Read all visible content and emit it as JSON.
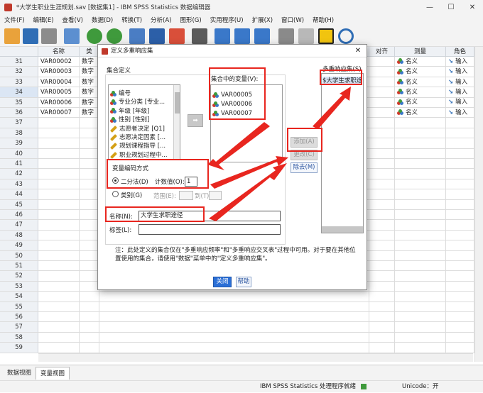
{
  "window": {
    "title": "*大学生职业生涯规划.sav [数据集1] - IBM SPSS Statistics 数据编辑器",
    "minimize": "—",
    "maximize": "☐",
    "close": "✕"
  },
  "menu": [
    "文件(F)",
    "编辑(E)",
    "查看(V)",
    "数据(D)",
    "转换(T)",
    "分析(A)",
    "图形(G)",
    "实用程序(U)",
    "扩展(X)",
    "窗口(W)",
    "帮助(H)"
  ],
  "sheet": {
    "headers": {
      "name": "名称",
      "type": "类",
      "align": "对齐",
      "measure": "测量",
      "role": "角色"
    },
    "rows": [
      {
        "n": "31",
        "name": "VAR00002",
        "type": "数字",
        "measure": "名义",
        "role": "输入"
      },
      {
        "n": "32",
        "name": "VAR00003",
        "type": "数字",
        "measure": "名义",
        "role": "输入"
      },
      {
        "n": "33",
        "name": "VAR00004",
        "type": "数字",
        "measure": "名义",
        "role": "输入"
      },
      {
        "n": "34",
        "name": "VAR00005",
        "type": "数字",
        "measure": "名义",
        "role": "输入"
      },
      {
        "n": "35",
        "name": "VAR00006",
        "type": "数字",
        "measure": "名义",
        "role": "输入"
      },
      {
        "n": "36",
        "name": "VAR00007",
        "type": "数字",
        "measure": "名义",
        "role": "输入"
      },
      {
        "n": "37"
      },
      {
        "n": "38"
      },
      {
        "n": "39"
      },
      {
        "n": "40"
      },
      {
        "n": "41"
      },
      {
        "n": "42"
      },
      {
        "n": "43"
      },
      {
        "n": "44"
      },
      {
        "n": "45"
      },
      {
        "n": "46"
      },
      {
        "n": "47"
      },
      {
        "n": "48"
      },
      {
        "n": "49"
      },
      {
        "n": "50"
      },
      {
        "n": "51"
      },
      {
        "n": "52"
      },
      {
        "n": "53"
      },
      {
        "n": "54"
      },
      {
        "n": "55"
      },
      {
        "n": "56"
      },
      {
        "n": "57"
      },
      {
        "n": "58"
      },
      {
        "n": "59"
      }
    ]
  },
  "dialog": {
    "title": "定义多重响应集",
    "set_definition_label": "集合定义",
    "source_vars": [
      "编号",
      "专业分类 [专业...",
      "年级 [年级]",
      "性别 [性别]",
      "志愿者决定 [Q1]",
      "志愿决定因素 [...",
      "规划课程指导 [...",
      "职业规划过程中..."
    ],
    "move_arrow": "➡",
    "vars_in_set_label": "集合中的变量(V):",
    "vars_in_set": [
      "VAR00005",
      "VAR00006",
      "VAR00007"
    ],
    "encoding_label": "变量编码方式",
    "dichotomy_label": "二分法(D)",
    "count_value_label": "计数值(O):",
    "count_value": "1",
    "categories_label": "类别(G)",
    "range_label": "范围(E):",
    "to_label": "到(T)",
    "name_label": "名称(N):",
    "name_value": "大学生求职途径",
    "label_label": "标签(L):",
    "label_value": "",
    "mr_sets_label": "多重响应集(S)",
    "mr_sets": [
      "$大学生求职途"
    ],
    "add_button": "添加(A)",
    "change_button": "更改(C)",
    "remove_button": "除去(M)",
    "note": "注：此处定义的集合仅在\"多重响应频率\"和\"多重响应交叉表\"过程中可用。对于要在其他位置使用的集合，请使用\"数据\"菜单中的\"定义多重响应集\"。",
    "close_button": "关闭",
    "help_button": "帮助"
  },
  "tabs": {
    "data_view": "数据视图",
    "variable_view": "变量视图"
  },
  "status": {
    "processor": "IBM SPSS Statistics 处理程序就绪",
    "unicode": "Unicode：开"
  },
  "colors": {
    "highlight": "#e8261f",
    "accent": "#2b6fd6"
  }
}
